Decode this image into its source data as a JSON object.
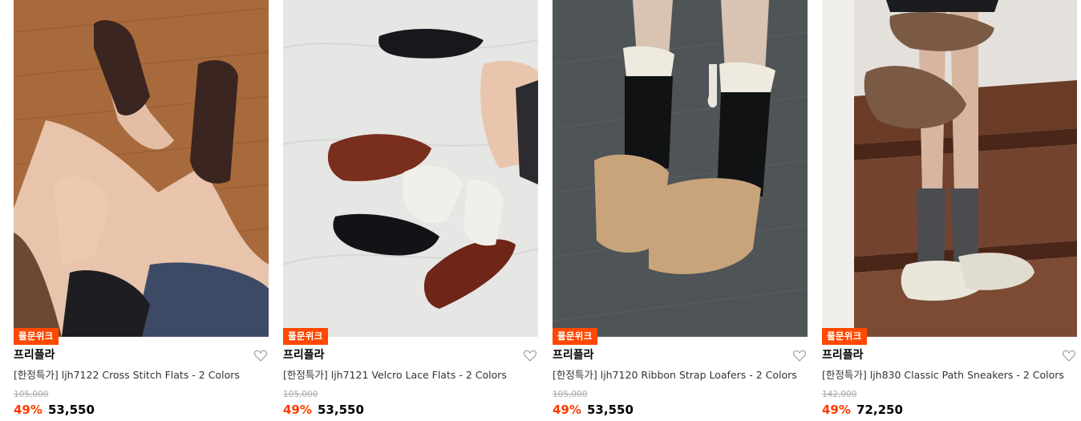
{
  "products": [
    {
      "badge": "풀문위크",
      "brand": "프리플라",
      "title": "[한정특가] ljh7122 Cross Stitch Flats - 2 Colors",
      "original_price": "105,000",
      "discount": "49%",
      "price": "53,550",
      "image": "photo of dark brown cross-stitch flats on wooden floor"
    },
    {
      "badge": "풀문위크",
      "brand": "프리플라",
      "title": "[한정특가] ljh7121 Velcro Lace Flats - 2 Colors",
      "original_price": "105,000",
      "discount": "49%",
      "price": "53,550",
      "image": "photo of black and brown velcro lace flats on white sheet"
    },
    {
      "badge": "풀문위크",
      "brand": "프리플라",
      "title": "[한정특가] ljh7120 Ribbon Strap Loafers - 2 Colors",
      "original_price": "105,000",
      "discount": "49%",
      "price": "53,550",
      "image": "photo of beige suede ribbon strap loafers with black socks"
    },
    {
      "badge": "풀문위크",
      "brand": "프리플라",
      "title": "[한정특가] ljh830 Classic Path Sneakers - 2 Colors",
      "original_price": "142,000",
      "discount": "49%",
      "price": "72,250",
      "image": "photo of cream and brown sneakers on wooden stairs"
    }
  ],
  "colors": {
    "badge_bg": "#ff4800",
    "discount": "#ff3a00"
  },
  "icons": {
    "like": "heart-outline-icon"
  }
}
